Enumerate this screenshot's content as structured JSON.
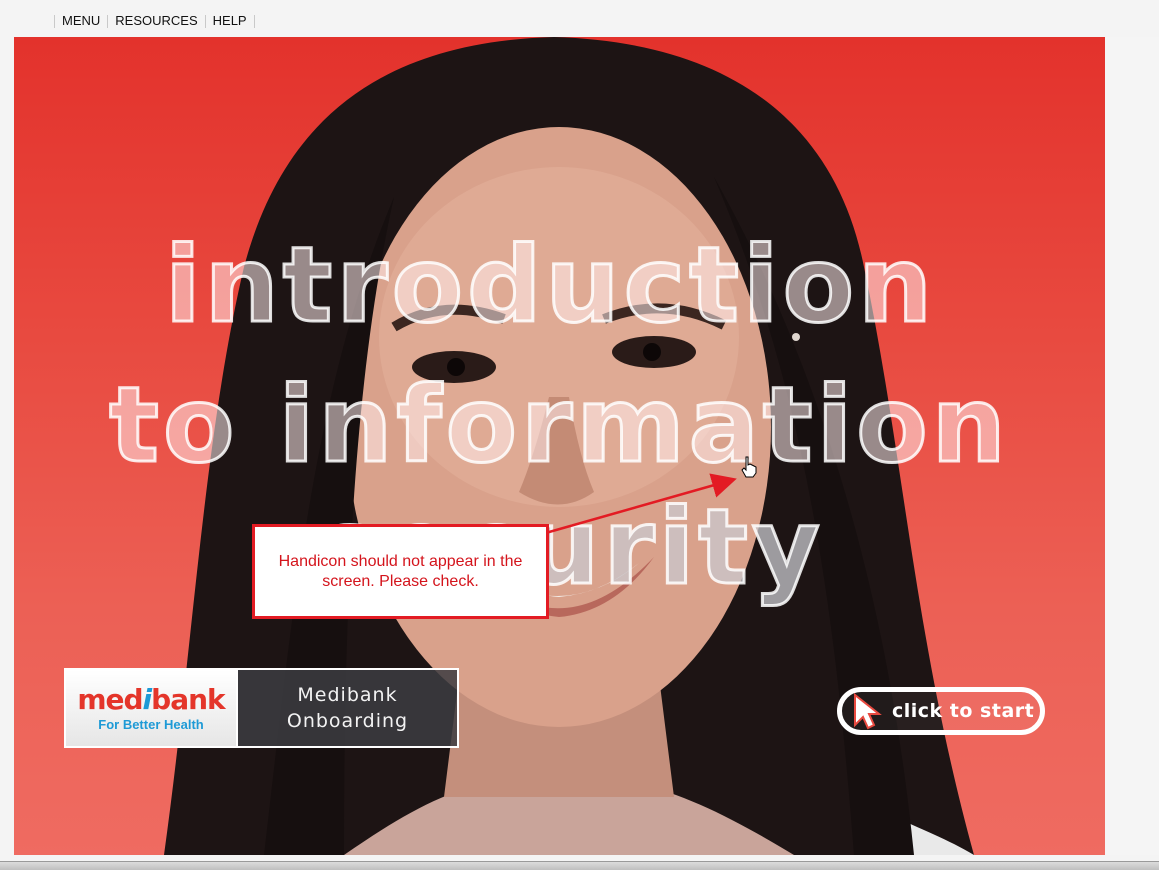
{
  "topnav": {
    "items": [
      {
        "label": "MENU"
      },
      {
        "label": "RESOURCES"
      },
      {
        "label": "HELP"
      }
    ]
  },
  "slide": {
    "title_lines": [
      "introduction",
      "to information",
      "security"
    ],
    "logo": {
      "brand_prefix": "med",
      "brand_i": "i",
      "brand_suffix": "bank",
      "tagline": "For Better Health"
    },
    "course_label_line1": "Medibank",
    "course_label_line2": "Onboarding",
    "start_button_label": "click to start"
  },
  "annotation": {
    "text": "Handicon should not appear in the screen. Please check."
  },
  "colors": {
    "stage_red": "#e3322c",
    "brand_red": "#e4352a",
    "brand_blue": "#1e9ad6",
    "annotation_red": "#e31b23"
  },
  "icons": {
    "start_pointer": "arrow-cursor-icon",
    "hand_cursor": "hand-pointer-icon"
  }
}
